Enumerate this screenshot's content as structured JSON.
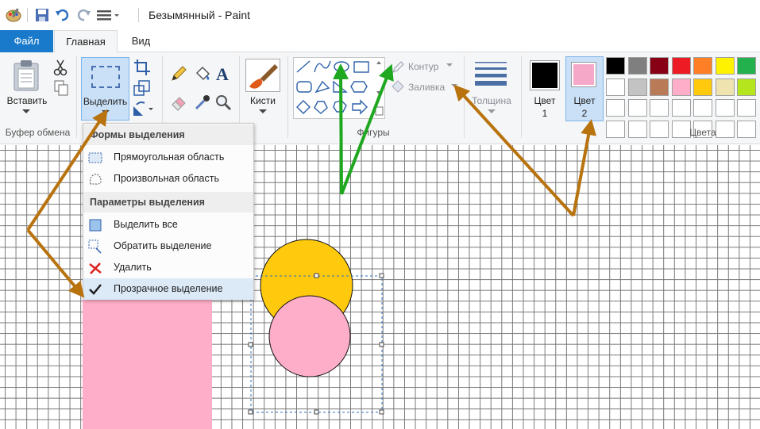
{
  "window": {
    "title": "Безымянный - Paint"
  },
  "tabs": {
    "file": "Файл",
    "home": "Главная",
    "view": "Вид"
  },
  "clipboard": {
    "paste": "Вставить",
    "group": "Буфер обмена"
  },
  "image": {
    "select": "Выделить"
  },
  "brushes": {
    "label": "Кисти"
  },
  "shapes": {
    "outline": "Контур",
    "fill": "Заливка",
    "group": "Фигуры"
  },
  "size": {
    "label": "Толщина"
  },
  "colors": {
    "color1": "Цвет",
    "color1_num": "1",
    "color2": "Цвет",
    "color2_num": "2",
    "group": "Цвета",
    "color1_value": "#000000",
    "color2_value": "#f6a8c8",
    "palette": [
      [
        "#000000",
        "#7f7f7f",
        "#880015",
        "#ed1c24",
        "#ff7f27",
        "#fff200",
        "#22b14c"
      ],
      [
        "#ffffff",
        "#c3c3c3",
        "#b97a57",
        "#ffaec9",
        "#ffc90e",
        "#efe4b0",
        "#b5e61d"
      ],
      [
        "#ffffff",
        "#ffffff",
        "#ffffff",
        "#ffffff",
        "#ffffff",
        "#ffffff",
        "#ffffff"
      ],
      [
        "#ffffff",
        "#ffffff",
        "#ffffff",
        "#ffffff",
        "#ffffff",
        "#ffffff",
        "#ffffff"
      ]
    ]
  },
  "select_menu": {
    "shapes_header": "Формы выделения",
    "rect": "Прямоугольная область",
    "free": "Произвольная область",
    "params_header": "Параметры выделения",
    "select_all": "Выделить все",
    "invert": "Обратить выделение",
    "delete": "Удалить",
    "transparent": "Прозрачное выделение"
  },
  "drawing": {
    "pink_rect_color": "#ffaec9",
    "circle_top_color": "#ffc90e",
    "circle_bottom_color": "#ffaec9"
  },
  "annotations": {
    "brown_arrow_color": "#b8730f",
    "green_arrow_color": "#1fa81f"
  }
}
